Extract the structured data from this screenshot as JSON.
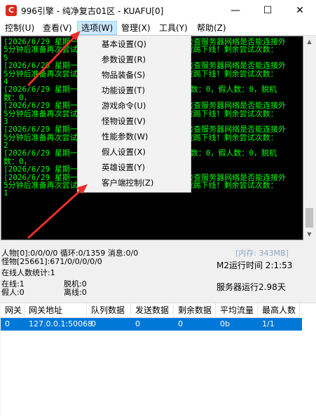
{
  "window": {
    "icon_label": "C",
    "title": "996引擎 - 纯净复古01区 - KUAFU[0]"
  },
  "window_buttons": {
    "minimize": "—",
    "maximize": "☐",
    "close": "✕"
  },
  "menubar": [
    {
      "label": "控制(U)"
    },
    {
      "label": "查看(V)"
    },
    {
      "label": "选项(W)"
    },
    {
      "label": "管理(X)"
    },
    {
      "label": "工具(Y)"
    },
    {
      "label": "帮助(Z)"
    }
  ],
  "dropdown": [
    {
      "label": "基本设置(Q)"
    },
    {
      "label": "参数设置(R)"
    },
    {
      "label": "物品装备(S)"
    },
    {
      "label": "功能设置(T)"
    },
    {
      "label": "游戏命令(U)"
    },
    {
      "label": "怪物设置(V)"
    },
    {
      "label": "性能参数(W)"
    },
    {
      "label": "假人设置(X)"
    },
    {
      "label": "英雄设置(Y)"
    },
    {
      "label": "客户端控制(Z)"
    }
  ],
  "console": [
    "[2026/6/29 星期一 11:34:24]授权获取异常，请检查服务器网络是否能连接外网，",
    "5分钟后准备再次尝试，如果连续多次失败在线玩家会被踢下线！剩余尝试次数：",
    "5",
    "[2026/6/29 星期一 11:34:24]授权获取异常，请检查服务器网络是否能连接外网，",
    "5分钟后准备再次尝试，如果连续多次失败在线玩家会被踢下线！剩余尝试次数：",
    "4",
    "[2026/6/29 星期一 11:34:35]在线人数：1，离线数：0，假人数：0，脱机",
    "数：0，",
    "[2026/6/29 星期一 11:34:24]授权获取异常，请检查服务器网络是否能连接外网，",
    "5分钟后准备再次尝试，如果连续多次失败在线玩家会被踢下线！剩余尝试次数：",
    "3",
    "[2026/6/29 星期一 11:34:24]授权获取异常，请检查服务器网络是否能连接外网，",
    "5分钟后准备再次尝试，如果连续多次失败在线玩家会被踢下线！剩余尝试次数：",
    "2",
    "[2026/6/29 星期一 11:34:35]在线人数：1，离线数：0，假人数：0，脱机",
    "数：0，",
    "[2026/6/29 星期一 11:35:35]在线人数：1(1)",
    "[2026/6/29 星期一 11:34:24]授权获取异常，请检查服务器网络是否能连接外网，",
    "5分钟后准备再次尝试，如果连续多次失败在线玩家会被踢下线！剩余尝试次数：",
    "1"
  ],
  "status": {
    "players": "人物[0]:0/0/0/0  循环:0/1359  消息:0/0",
    "monsters": "怪物[25661]:671/0/0/0/0/0",
    "memory": "[内存: 343MB]",
    "runtime": "M2运行时间 2:1:53",
    "online_stats": "在线人数统计:1",
    "online": "在线:1",
    "offline_bot": "脱机:0",
    "fake": "假人:0",
    "disconnected": "离线:0",
    "server_uptime": "服务器运行2.98天"
  },
  "grid": {
    "headers": [
      "网关",
      "网关地址",
      "队列数据",
      "发送数据",
      "剩余数据",
      "平均流量",
      "最高人数"
    ],
    "rows": [
      [
        "0",
        "127.0.0.1:50068",
        "0",
        "0",
        "0",
        "0b",
        "1/1"
      ]
    ]
  },
  "colors": {
    "console_bg": "#000000",
    "console_text": "#00ff00",
    "accent": "#0078d7",
    "annotation_arrow": "#e8302a"
  }
}
